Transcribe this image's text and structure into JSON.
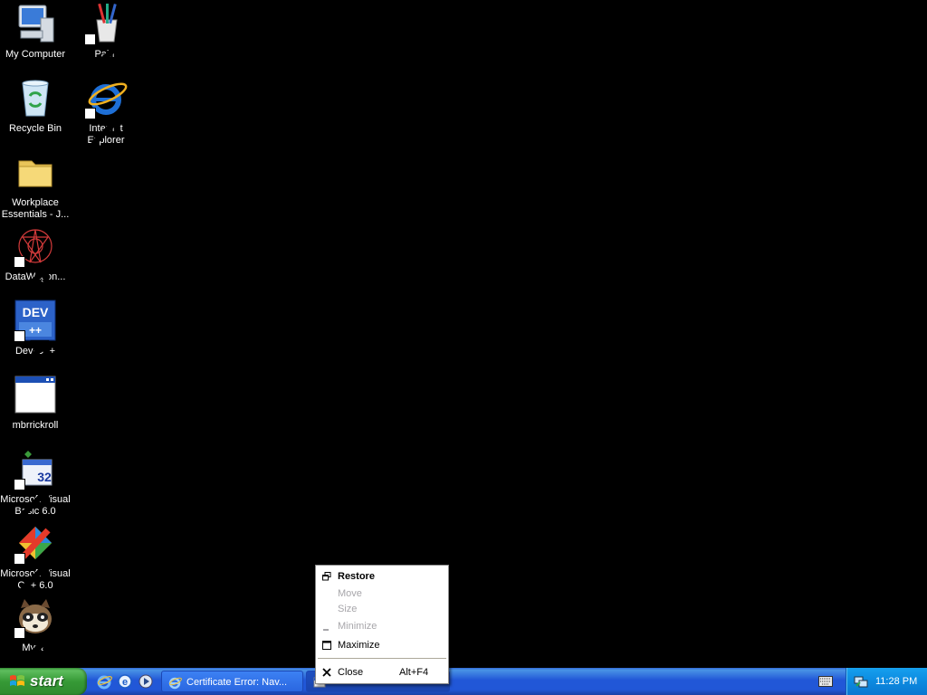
{
  "desktop": {
    "icons": [
      {
        "label": "My Computer",
        "icon": "my-computer-icon"
      },
      {
        "label": "Paint",
        "icon": "paint-icon"
      },
      {
        "label": "Recycle Bin",
        "icon": "recycle-bin-icon"
      },
      {
        "label": "Internet Explorer",
        "icon": "internet-explorer-icon"
      },
      {
        "label": "Workplace Essentials - J...",
        "icon": "folder-icon"
      },
      {
        "label": "DataWagon...",
        "icon": "datawagon-icon"
      },
      {
        "label": "Dev-C++",
        "icon": "dev-cpp-icon"
      },
      {
        "label": "mbrrickroll",
        "icon": "program-window-icon"
      },
      {
        "label": "Microsoft Visual Basic 6.0",
        "icon": "visual-basic-icon"
      },
      {
        "label": "Microsoft Visual C++ 6.0",
        "icon": "visual-cpp-icon"
      },
      {
        "label": "Mypal",
        "icon": "mypal-icon"
      }
    ]
  },
  "context_menu": {
    "items": [
      {
        "label": "Restore",
        "enabled": true,
        "default": true,
        "icon": "restore-icon"
      },
      {
        "label": "Move",
        "enabled": false
      },
      {
        "label": "Size",
        "enabled": false
      },
      {
        "label": "Minimize",
        "enabled": false,
        "icon": "minimize-icon"
      },
      {
        "label": "Maximize",
        "enabled": true,
        "icon": "maximize-icon"
      },
      {
        "label": "Close",
        "enabled": true,
        "shortcut": "Alt+F4",
        "icon": "close-icon"
      }
    ]
  },
  "taskbar": {
    "start_label": "start",
    "quick_launch": [
      "internet-explorer-icon",
      "browser-icon",
      "media-player-icon"
    ],
    "tasks": [
      {
        "label": "Certificate Error: Nav...",
        "icon": "internet-explorer-icon"
      },
      {
        "label": "",
        "icon": "window-icon"
      }
    ],
    "clock": "11:28 PM",
    "colors": {
      "bar": "#2157d7",
      "start": "#3c9c3c",
      "tray": "#0c8ae0"
    }
  }
}
